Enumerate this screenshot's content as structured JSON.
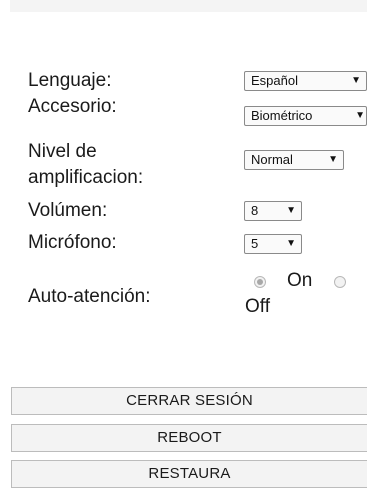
{
  "settings": {
    "language": {
      "label": "Lenguaje:",
      "value": "Español"
    },
    "accessory": {
      "label": "Accesorio:",
      "value": "Biométrico"
    },
    "amplification": {
      "label_line1": "Nivel de",
      "label_line2": "amplificacion:",
      "value": "Normal"
    },
    "volume": {
      "label": "Volúmen:",
      "value": "8"
    },
    "microphone": {
      "label": "Micrófono:",
      "value": "5"
    },
    "auto_attention": {
      "label": "Auto-atención:",
      "options": [
        {
          "label": "On",
          "checked": true
        },
        {
          "label": "Off",
          "checked": false
        }
      ]
    }
  },
  "buttons": {
    "logout": "CERRAR SESIÓN",
    "reboot": "REBOOT",
    "restore": "RESTAURA"
  },
  "icons": {
    "dropdown_caret": "▼"
  }
}
